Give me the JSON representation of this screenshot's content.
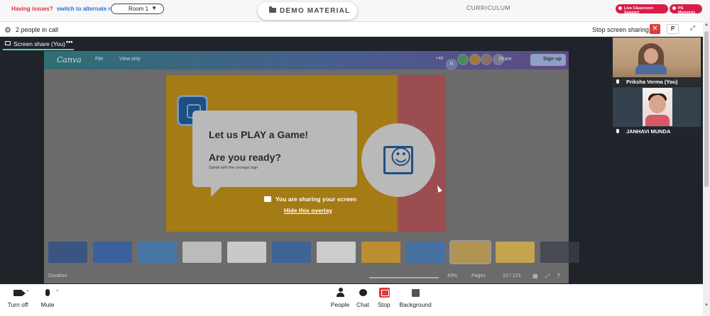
{
  "topbar": {
    "issues_text": "Having issues?",
    "alternate_link": "switch to alternate room",
    "room_value": "Room 1",
    "demo_material": "DEMO MATERIAL",
    "curriculum": "CURRICULUM",
    "live_support": "Live Classroom Support",
    "ps_moments": "PS Moments",
    "colors": {
      "pill": "#d81d4b",
      "link": "#2a6fd6",
      "issues": "#d6333d"
    }
  },
  "callbar": {
    "people_in_call": "2 people in call",
    "stop_screen_sharing": "Stop screen sharing",
    "close_symbol": "✕",
    "p_label": "P"
  },
  "stage": {
    "share_tab_label": "Screen share (You)",
    "share_tab_more": "•••",
    "overlay_message": "You are sharing your screen",
    "overlay_link": "Hide this overlay"
  },
  "canva": {
    "logo": "Canva",
    "file": "File",
    "view_only": "View only",
    "plus_count": "+48",
    "avatar_initial": "N",
    "share": "Share",
    "sign_up": "Sign up",
    "slide": {
      "title": "Let us PLAY a Game!",
      "subtitle": "Are you ready?",
      "small": "Speak with the courage sign"
    },
    "bottom": {
      "duration": "Duration",
      "zoom": "43%",
      "pages": "Pages",
      "page_count": "10 / 123"
    },
    "thumbnail_colors": [
      "#2a4e8a",
      "#2a5ea8",
      "#3b78b8",
      "#d6d6d6",
      "#e8e8e8",
      "#2e62a3",
      "#ececec",
      "#d69a1e",
      "#3a72b3",
      "#c9a24a",
      "#e0b845",
      "#3b3f4a"
    ]
  },
  "participants": [
    {
      "name": "Priksha Verma (You)"
    },
    {
      "name": "JANHAVI MUNDA"
    }
  ],
  "controls": {
    "turn_off": "Turn off",
    "mute": "Mute",
    "people": "People",
    "chat": "Chat",
    "stop": "Stop",
    "background": "Background"
  }
}
